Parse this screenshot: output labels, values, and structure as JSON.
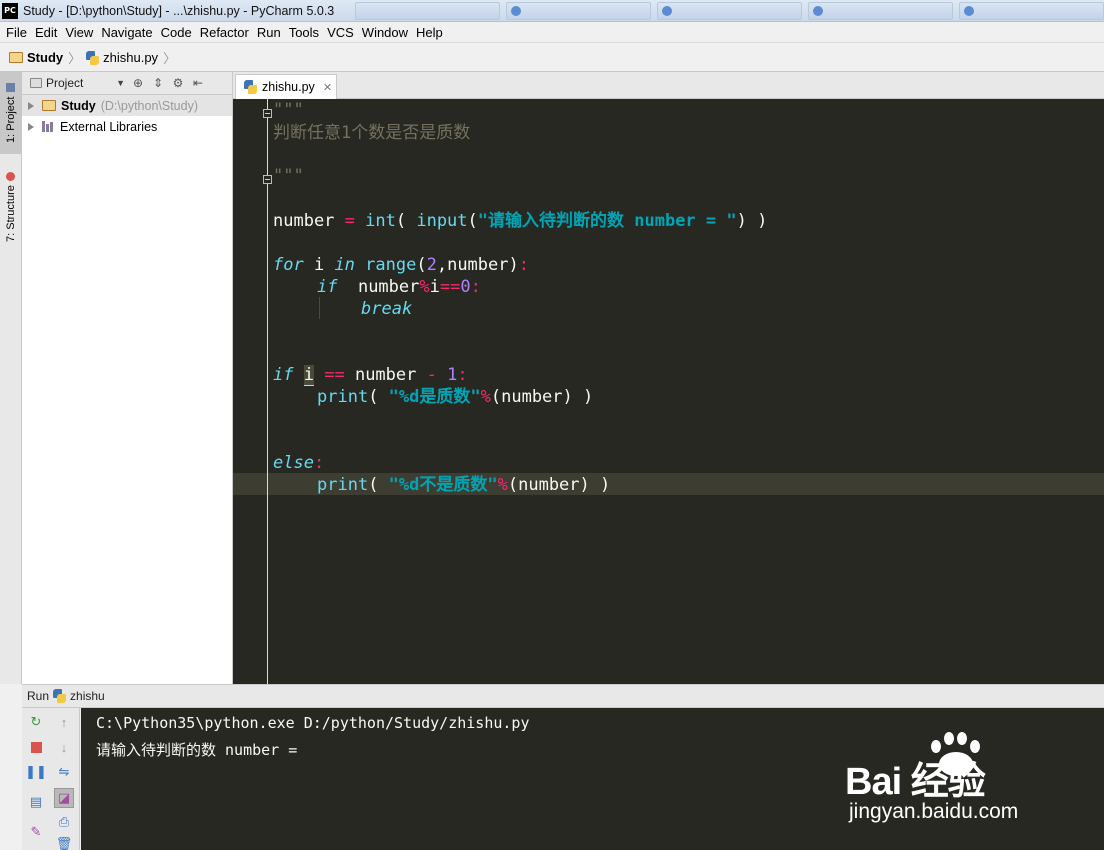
{
  "window": {
    "title": "Study - [D:\\python\\Study] - ...\\zhishu.py - PyCharm 5.0.3",
    "logo_text": "PC"
  },
  "menu": [
    "File",
    "Edit",
    "View",
    "Navigate",
    "Code",
    "Refactor",
    "Run",
    "Tools",
    "VCS",
    "Window",
    "Help"
  ],
  "breadcrumb": {
    "project": "Study",
    "file": "zhishu.py"
  },
  "left_strip": {
    "tab1": "1: Project",
    "tab2": "7: Structure"
  },
  "project_panel": {
    "view_label": "Project",
    "root_name": "Study",
    "root_path": "(D:\\python\\Study)",
    "libraries": "External Libraries"
  },
  "editor": {
    "tab_label": "zhishu.py",
    "docstring_open": "\"\"\"",
    "docstring_text": "判断任意1个数是否是质数",
    "docstring_close": "\"\"\"",
    "line_number_prefix": "number ",
    "eq": "= ",
    "int_call": "int",
    "open1": "( ",
    "input_call": "input",
    "open2": "(",
    "prompt_str": "\"请输入待判断的数 number = \"",
    "close_parens": ") )",
    "for_kw": "for",
    "for_var": " i ",
    "in_kw": "in",
    "range_call": " range",
    "range_args_a": "(",
    "range_num": "2",
    "range_args_b": ",number)",
    "colon": ":",
    "if_kw": "if",
    "cond1_a": "  number",
    "mod_op": "%",
    "cond1_b": "i",
    "eqeq": "==",
    "zero": "0",
    "break_kw": "break",
    "if2_kw": "if",
    "if2_var": "i",
    "if2_eq": "==",
    "if2_number": " number ",
    "minus": "-",
    "one": "1",
    "print1_call": "print",
    "print1_open": "( ",
    "print1_str": "\"%d是质数\"",
    "print1_mod": "%",
    "print1_rest": "(number) )",
    "else_kw": "else",
    "print2_call": "print",
    "print2_open": "( ",
    "print2_str": "\"%d不是质数\"",
    "print2_mod": "%",
    "print2_rest": "(number) )"
  },
  "run_panel": {
    "label": "Run",
    "config": "zhishu",
    "console_cmd": "C:\\Python35\\python.exe D:/python/Study/zhishu.py",
    "console_prompt": "请输入待判断的数 number ="
  },
  "watermark": {
    "brand": "Bai  经验",
    "url": "jingyan.baidu.com"
  },
  "colors": {
    "editor_bg": "#272822",
    "keyword": "#66d9ef",
    "operator": "#f92672",
    "number": "#ae81ff",
    "string": "#00a5b5",
    "comment": "#75715e"
  }
}
